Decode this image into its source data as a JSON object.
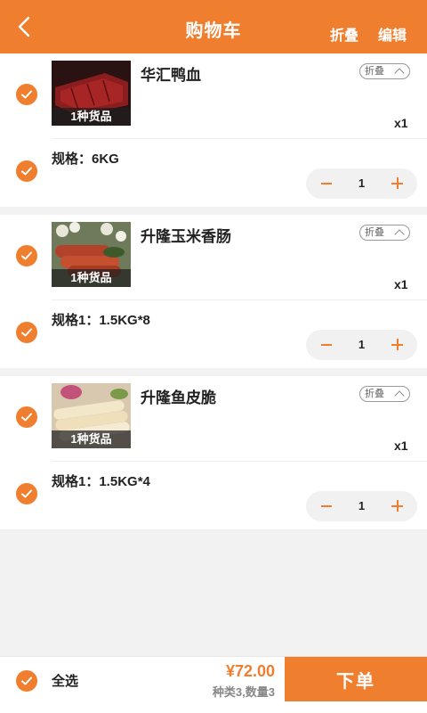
{
  "header": {
    "title": "购物车",
    "fold_label": "折叠",
    "edit_label": "编辑"
  },
  "items": [
    {
      "name": "华汇鸭血",
      "badge": "1种货品",
      "fold_tag": "折叠",
      "qty_label": "x1",
      "spec": "规格：6KG",
      "quantity": "1"
    },
    {
      "name": "升隆玉米香肠",
      "badge": "1种货品",
      "fold_tag": "折叠",
      "qty_label": "x1",
      "spec": "规格1：1.5KG*8",
      "quantity": "1"
    },
    {
      "name": "升隆鱼皮脆",
      "badge": "1种货品",
      "fold_tag": "折叠",
      "qty_label": "x1",
      "spec": "规格1：1.5KG*4",
      "quantity": "1"
    }
  ],
  "footer": {
    "select_all_label": "全选",
    "total_price": "¥72.00",
    "summary": "种类3,数量3",
    "order_label": "下单"
  },
  "colors": {
    "accent": "#ef7f2f",
    "background": "#f2f2f2"
  },
  "icons": {
    "back": "chevron-left-icon",
    "check": "check-circle-icon",
    "minus": "minus-icon",
    "plus": "plus-icon",
    "fold": "chevron-up-icon"
  }
}
